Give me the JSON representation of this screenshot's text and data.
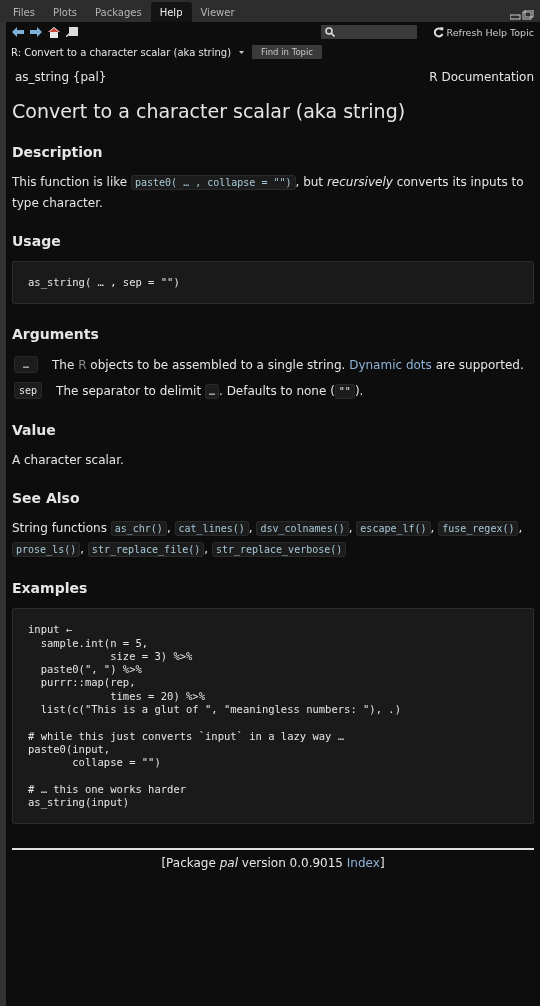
{
  "tabs": [
    {
      "label": "Files",
      "selected": false
    },
    {
      "label": "Plots",
      "selected": false
    },
    {
      "label": "Packages",
      "selected": false
    },
    {
      "label": "Help",
      "selected": true
    },
    {
      "label": "Viewer",
      "selected": false
    }
  ],
  "toolbar": {
    "refresh": "Refresh Help Topic"
  },
  "topic": {
    "title": "R: Convert to a character scalar (aka string)",
    "find_button": "Find in Topic"
  },
  "doc": {
    "header_left": "as_string {pal}",
    "header_right": "R Documentation",
    "title": "Convert to a character scalar (aka string)",
    "sections": [
      {
        "heading": "Description",
        "kind": "paragraph",
        "segments": [
          {
            "kind": "text",
            "text": "This function is like "
          },
          {
            "kind": "code",
            "text": "paste0( … , collapse = \"\")"
          },
          {
            "kind": "text",
            "text": ", but *recursively* converts its inputs to type character."
          }
        ]
      },
      {
        "heading": "Usage",
        "kind": "codeblock",
        "code": "as_string( … , sep = \"\")"
      },
      {
        "heading": "Arguments",
        "kind": "arguments",
        "arguments": [
          {
            "name": "…",
            "segments": [
              {
                "kind": "text",
                "text": "The "
              },
              {
                "kind": "muted",
                "text": "R"
              },
              {
                "kind": "text",
                "text": " objects to be assembled to a single string. "
              },
              {
                "kind": "link",
                "text": "Dynamic dots"
              },
              {
                "kind": "text",
                "text": " are supported."
              }
            ]
          },
          {
            "name": "sep",
            "segments": [
              {
                "kind": "text",
                "text": "The separator to delimit "
              },
              {
                "kind": "code",
                "text": "…"
              },
              {
                "kind": "text",
                "text": ". Defaults to none ("
              },
              {
                "kind": "code",
                "text": "\"\""
              },
              {
                "kind": "text",
                "text": ")."
              }
            ]
          }
        ]
      },
      {
        "heading": "Value",
        "kind": "paragraph",
        "segments": [
          {
            "kind": "text",
            "text": "A character scalar."
          }
        ]
      },
      {
        "heading": "See Also",
        "kind": "paragraph",
        "segments": [
          {
            "kind": "text",
            "text": "String functions "
          },
          {
            "kind": "code",
            "text": "as_chr()"
          },
          {
            "kind": "text",
            "text": ", "
          },
          {
            "kind": "code",
            "text": "cat_lines()"
          },
          {
            "kind": "text",
            "text": ", "
          },
          {
            "kind": "code",
            "text": "dsv_colnames()"
          },
          {
            "kind": "text",
            "text": ", "
          },
          {
            "kind": "code",
            "text": "escape_lf()"
          },
          {
            "kind": "text",
            "text": ", "
          },
          {
            "kind": "code",
            "text": "fuse_regex()"
          },
          {
            "kind": "text",
            "text": ", "
          },
          {
            "kind": "code",
            "text": "prose_ls()"
          },
          {
            "kind": "text",
            "text": ", "
          },
          {
            "kind": "code",
            "text": "str_replace_file()"
          },
          {
            "kind": "text",
            "text": ", "
          },
          {
            "kind": "code",
            "text": "str_replace_verbose()"
          }
        ]
      },
      {
        "heading": "Examples",
        "kind": "codeblock",
        "code": "input ←\n  sample.int(n = 5,\n             size = 3) %>%\n  paste0(\", \") %>%\n  purrr::map(rep,\n             times = 20) %>%\n  list(c(\"This is a glut of \", \"meaningless numbers: \"), .)\n\n# while this just converts `input` in a lazy way …\npaste0(input,\n       collapse = \"\")\n\n# … this one works harder\nas_string(input)"
      }
    ]
  },
  "footer": [
    {
      "kind": "text",
      "text": "[Package *pal* version 0.0.9015 "
    },
    {
      "kind": "link",
      "text": "Index"
    },
    {
      "kind": "text",
      "text": "]"
    }
  ]
}
